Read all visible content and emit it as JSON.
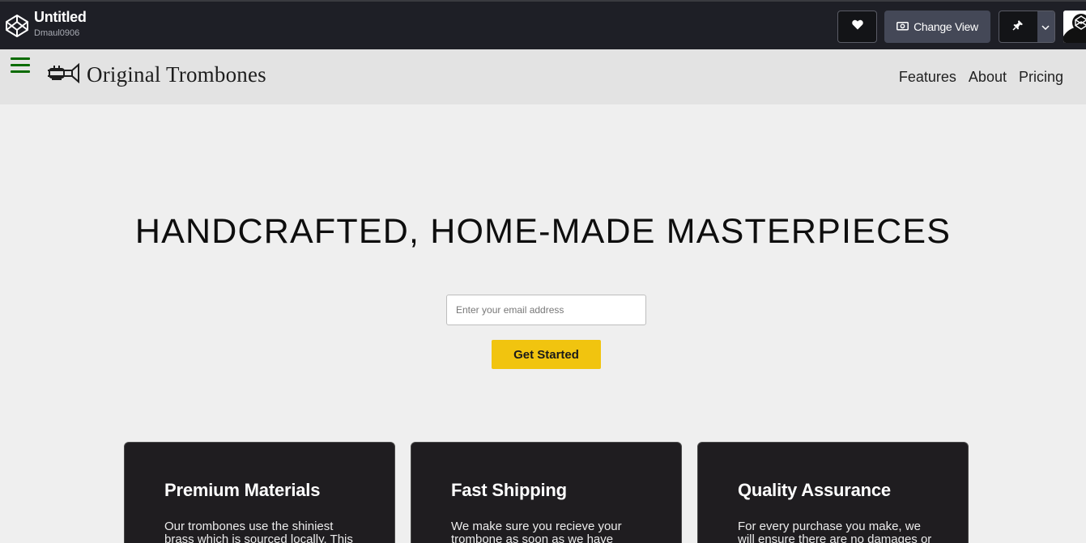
{
  "codepen": {
    "title": "Untitled",
    "username": "Dmaul0906",
    "change_view_label": "Change View",
    "icons": [
      "codepen-logo-icon",
      "heart-icon",
      "eye-icon",
      "pin-icon",
      "chevron-down-icon"
    ]
  },
  "site": {
    "brand": "Original Trombones",
    "nav": [
      "Features",
      "About",
      "Pricing"
    ],
    "accent_color": "#f1c40f",
    "menu_color": "#0a6b00"
  },
  "hero": {
    "title": "HANDCRAFTED, HOME-MADE MASTERPIECES",
    "email_placeholder": "Enter your email address",
    "cta_label": "Get Started"
  },
  "features": [
    {
      "title": "Premium Materials",
      "text": "Our trombones use the shiniest brass which is sourced locally. This"
    },
    {
      "title": "Fast Shipping",
      "text": "We make sure you recieve your trombone as soon as we have"
    },
    {
      "title": "Quality Assurance",
      "text": "For every purchase you make, we will ensure there are no damages or"
    }
  ]
}
